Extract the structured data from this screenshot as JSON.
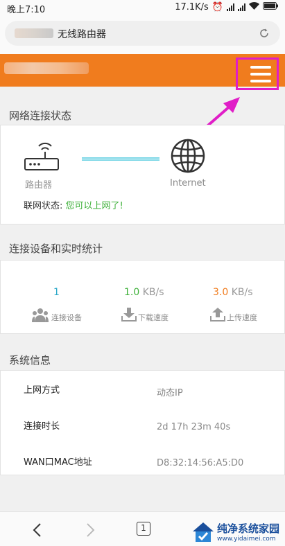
{
  "status_bar": {
    "time": "晚上7:10",
    "speed": "17.1K/s"
  },
  "browser": {
    "page_title": "无线路由器"
  },
  "network": {
    "section_title": "网络连接状态",
    "router_label": "路由器",
    "internet_label": "Internet",
    "status_label": "联网状态:",
    "status_value": "您可以上网了!"
  },
  "stats": {
    "section_title": "连接设备和实时统计",
    "devices": {
      "value": "1",
      "label": "连接设备"
    },
    "download": {
      "value": "1.0",
      "unit": "KB/s",
      "label": "下载速度"
    },
    "upload": {
      "value": "3.0",
      "unit": "KB/s",
      "label": "上传速度"
    }
  },
  "sysinfo": {
    "section_title": "系统信息",
    "rows": [
      {
        "label": "上网方式",
        "value": "动态IP"
      },
      {
        "label": "连接时长",
        "value": "2d 17h 23m 40s"
      },
      {
        "label": "WAN口MAC地址",
        "value": "D8:32:14:56:A5:D0"
      }
    ]
  },
  "nav": {
    "tab_count": "1"
  },
  "watermark": {
    "name": "纯净系统家园",
    "url": "www.yidaimei.com"
  },
  "colors": {
    "header": "#f07c1e",
    "highlight": "#e01ec7",
    "ok": "#3db038",
    "devices": "#2aa8c8",
    "download": "#3db038",
    "upload": "#f07c1e"
  }
}
